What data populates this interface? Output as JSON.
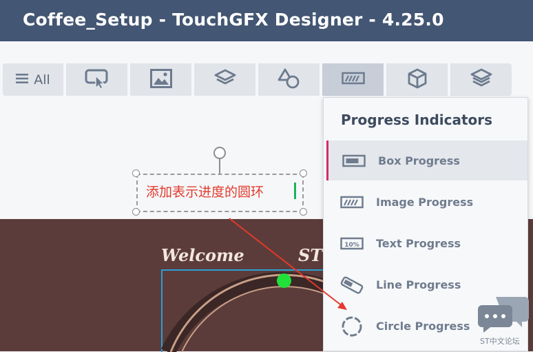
{
  "window": {
    "title": "Coffee_Setup - TouchGFX Designer - 4.25.0"
  },
  "toolbar": {
    "all_label": "All",
    "buttons": [
      {
        "icon": "menu-icon"
      },
      {
        "icon": "touch-button-icon"
      },
      {
        "icon": "image-icon"
      },
      {
        "icon": "layers-icon"
      },
      {
        "icon": "shapes-icon"
      },
      {
        "icon": "progress-icon",
        "active": true
      },
      {
        "icon": "cube-icon"
      },
      {
        "icon": "stack-icon"
      }
    ]
  },
  "annotation": {
    "text": "添加表示进度的圆环"
  },
  "canvas": {
    "welcome": "Welcome",
    "welcome_tail": "ST"
  },
  "popup": {
    "title": "Progress Indicators",
    "items": [
      {
        "label": "Box Progress",
        "icon": "box-progress-icon",
        "selected": true
      },
      {
        "label": "Image Progress",
        "icon": "image-progress-icon"
      },
      {
        "label": "Text Progress",
        "icon": "text-progress-icon"
      },
      {
        "label": "Line Progress",
        "icon": "line-progress-icon"
      },
      {
        "label": "Circle Progress",
        "icon": "circle-progress-icon"
      }
    ],
    "text_progress_icon_label": "10%"
  },
  "watermark": {
    "text": "ST中文论坛"
  },
  "colors": {
    "titlebar": "#435673",
    "accent": "#d32b6c",
    "annotation": "#e23a2c",
    "canvas_brown": "#5c3c3a",
    "green_dot": "#22e03a"
  }
}
